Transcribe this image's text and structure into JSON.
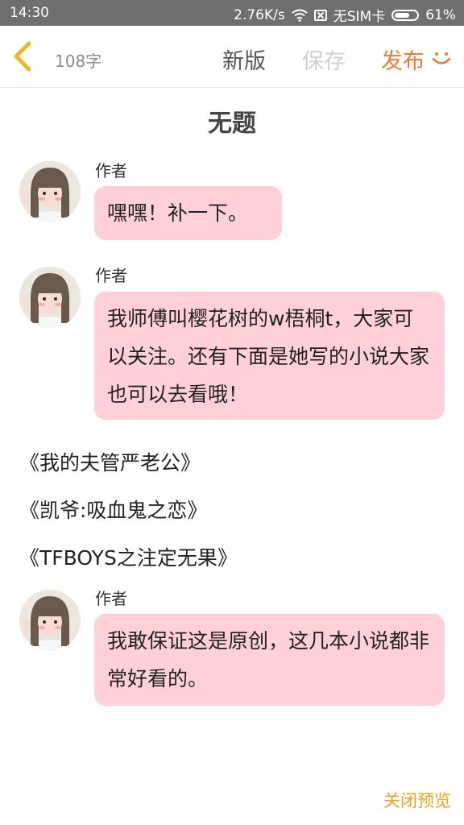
{
  "status": {
    "time": "14:30",
    "speed": "2.76K/s",
    "sim": "无SIM卡",
    "battery": "61%"
  },
  "toolbar": {
    "word_count": "108字",
    "new_label": "新版",
    "save_label": "保存",
    "publish_label": "发布"
  },
  "title": "无题",
  "messages": [
    {
      "author": "作者",
      "text": "嘿嘿！补一下。"
    },
    {
      "author": "作者",
      "text": "我师傅叫樱花树的w梧桐t，大家可以关注。还有下面是她写的小说大家也可以去看哦！"
    },
    {
      "author": "作者",
      "text": "我敢保证这是原创，这几本小说都非常好看的。"
    }
  ],
  "novels": [
    "《我的夫管严老公》",
    "《凯爷:吸血鬼之恋》",
    "《TFBOYS之注定无果》"
  ],
  "footer": {
    "close_preview": "关闭预览"
  },
  "colors": {
    "accent": "#ee7a33",
    "bubble": "#ffd0d8",
    "back_arrow": "#e8b92e",
    "close_preview": "#f0a020"
  }
}
